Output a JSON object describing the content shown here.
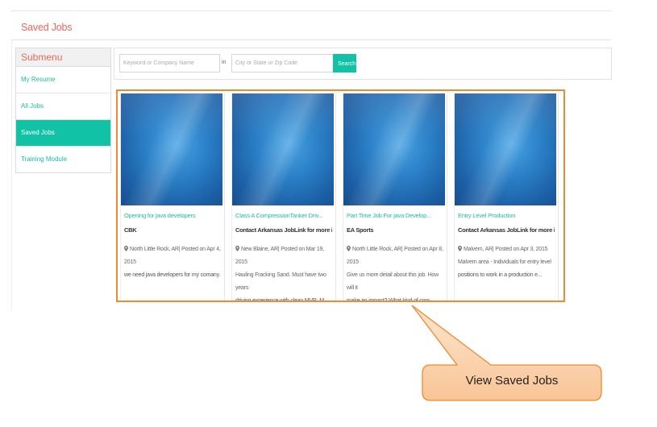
{
  "page": {
    "title": "Saved Jobs"
  },
  "sidebar": {
    "heading": "Submenu",
    "items": [
      {
        "label": "My Resume",
        "active": false
      },
      {
        "label": "All Jobs",
        "active": false
      },
      {
        "label": "Saved Jobs",
        "active": true
      },
      {
        "label": "Training Module",
        "active": false
      }
    ]
  },
  "search": {
    "keyword_placeholder": "Keyword or Company Name",
    "in_label": "in",
    "location_placeholder": "City or State or Zip Code",
    "button_label": "Search"
  },
  "jobs": [
    {
      "title": "Opening for java developers",
      "company": "CBK",
      "meta_line1": "North Little Rock, AR| Posted on Apr 4,",
      "meta_line2": "2015",
      "desc_line1": "we need java developers for my comany.",
      "desc_line2": ""
    },
    {
      "title": "Class A CompressionTanker Driv...",
      "company": "Contact Arkansas JobLink for more information",
      "meta_line1": "New Blaine, AR| Posted on Mar 19, 2015",
      "meta_line2": "Hauling Fracking Sand. Must have two years",
      "desc_line1": "driving experience with clean MVR. M...",
      "desc_line2": ""
    },
    {
      "title": "Part Time Job For java Develop...",
      "company": "EA Sports",
      "meta_line1": "North Little Rock, AR| Posted on Apr 8, 2015",
      "meta_line2": "Give us more detail about this job. How will it",
      "desc_line1": "make an impact? What kind of com...",
      "desc_line2": ""
    },
    {
      "title": "Entry Level Production",
      "company": "Contact Arkansas JobLink for more information",
      "meta_line1": "Malvern, AR| Posted on Apr 3, 2015",
      "meta_line2": "Malvern area - Individuals for entry level",
      "desc_line1": "positions to work in a production e...",
      "desc_line2": ""
    }
  ],
  "callout": {
    "label": "View Saved Jobs"
  },
  "colors": {
    "accent": "#12c2a4",
    "title": "#f0645c",
    "highlight": "#f08a32",
    "callout_fill": "#fbd2a8"
  }
}
